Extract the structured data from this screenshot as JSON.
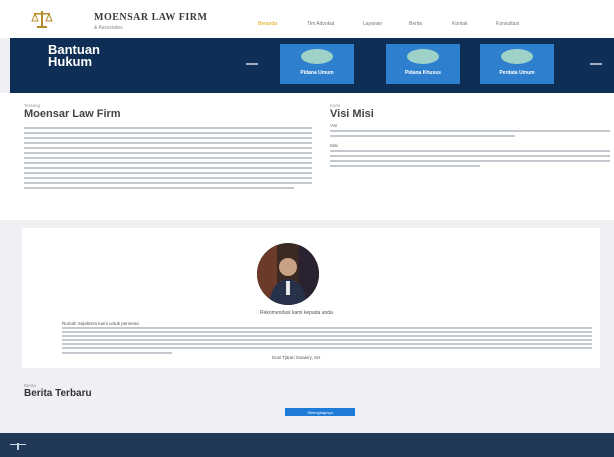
{
  "header": {
    "brand": "MOENSAR LAW FIRM",
    "brand_sub": "& Associates",
    "nav": [
      "Beranda",
      "Tim Advokat",
      "Layanan",
      "Berita",
      "Kontak",
      "Konsultasi"
    ]
  },
  "hero": {
    "title": "Bantuan Hukum",
    "cards": [
      "Pidana Umum",
      "Pidana Khusus",
      "Perdata Umum"
    ]
  },
  "about": {
    "eyebrow": "Tentang",
    "title": "Moensar Law Firm",
    "vision_eyebrow": "Kami",
    "vision_title": "Visi Misi",
    "visi_label": "Visi",
    "misi_label": "Misi"
  },
  "testimonial": {
    "caption": "Rekomendasi kami kepada anda",
    "quote_label": "Rumah Sejahtera kami untuk perseran",
    "author": "Dosi Tjitrari Soewiry, SH"
  },
  "news": {
    "eyebrow": "Berita",
    "title": "Berita Terbaru",
    "button": "Selengkapnya"
  },
  "colors": {
    "accent": "#e0a500",
    "hero_bg": "#0e2e55",
    "card_bg": "#2f7fcf",
    "footer_bg": "#213858"
  }
}
